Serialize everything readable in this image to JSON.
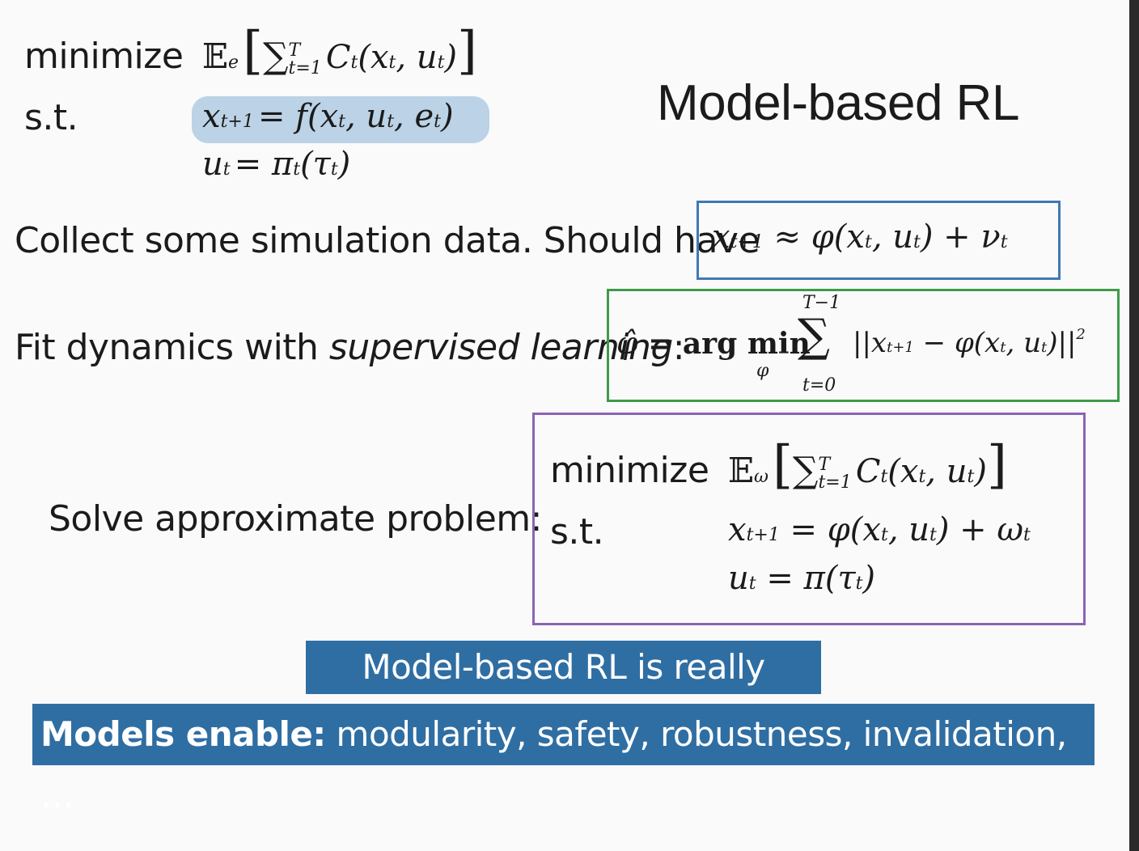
{
  "slide": {
    "title": "Model-based RL",
    "problem": {
      "minimize_label": "minimize",
      "st_label": "s.t.",
      "exp_symbol": "𝔼",
      "exp_sub": "e",
      "sum_upper": "T",
      "sum_lower": "t=1",
      "cost": "C",
      "cost_sub": "t",
      "cost_args": "(x",
      "args_rest": ", u",
      "dyn_lhs": "x",
      "dyn_lhs_sub": "t+1",
      "dyn_rhs": "= f(x",
      "dyn_rhs_rest": ", u",
      "dyn_rhs_rest2": ", e",
      "policy_lhs": "u",
      "policy_rhs": "= π",
      "policy_arg": "(τ",
      "t": "t"
    },
    "collect": {
      "text": "Collect some simulation data. Should have",
      "formula": "x",
      "formula_sub": "t+1",
      "formula_rest": " ≈ φ(x",
      "formula_rest2": ", u",
      "formula_rest3": ") + ν",
      "t": "t"
    },
    "fit": {
      "text_plain": "Fit dynamics with ",
      "text_italic": "supervised learning",
      "text_colon": ":",
      "phi_hat": "φ̂",
      "eq": " = arg min",
      "min_sub": "φ",
      "sum_upper": "T−1",
      "sum_lower": "t=0",
      "norm_open": "||x",
      "norm_sub": "t+1",
      "norm_rest": " − φ(x",
      "norm_rest2": ", u",
      "norm_close": ")||",
      "power": "2",
      "t": "t"
    },
    "solve": {
      "label": "Solve approximate problem:",
      "minimize_label": "minimize",
      "st_label": "s.t.",
      "exp_symbol": "𝔼",
      "exp_sub": "ω",
      "sum_upper": "T",
      "sum_lower": "t=1",
      "cost": "C",
      "cost_sub": "t",
      "cost_args": "(x",
      "args_rest": ", u",
      "dyn_lhs": "x",
      "dyn_lhs_sub": "t+1",
      "dyn_rhs": " = φ(x",
      "dyn_rhs_rest": ", u",
      "dyn_rhs_rest2": ") + ω",
      "policy_lhs": "u",
      "policy_rhs": " = π(τ",
      "t": "t"
    },
    "banner1": "Model-based RL is really simple.",
    "banner2_bold": "Models enable:",
    "banner2_rest": " modularity, safety, robustness, invalidation, …"
  },
  "colors": {
    "highlight": "#bcd2e6",
    "box_blue": "#3f78b8",
    "box_green": "#3f9a4a",
    "box_purple": "#8a63b5",
    "banner": "#2f6ea3"
  }
}
